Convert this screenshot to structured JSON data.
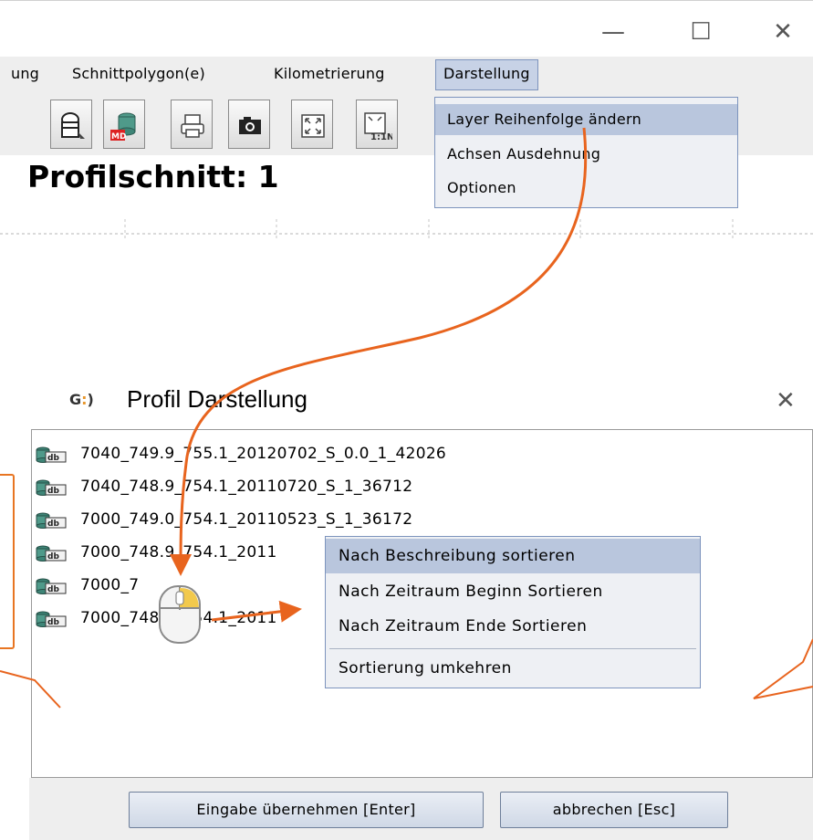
{
  "window": {
    "minimize_glyph": "—",
    "maximize_glyph": "☐",
    "close_glyph": "✕"
  },
  "menubar": {
    "items": [
      "ung",
      "Schnittpolygon(e)",
      "Kilometrierung",
      "Darstellung"
    ]
  },
  "toolbar": {
    "icons": [
      "select-tool-icon",
      "database-md-icon",
      "print-icon",
      "camera-icon",
      "zoom-extent-icon",
      "zoom-1-1-icon"
    ],
    "zoom_label": "1:1N"
  },
  "profile_title": "Profilschnitt: 1",
  "darstellung_menu": {
    "items": [
      "Layer Reihenfolge ändern",
      "Achsen Ausdehnung",
      "Optionen"
    ],
    "selected_index": 0
  },
  "dialog": {
    "logo": "G:)",
    "title": "Profil Darstellung",
    "close_glyph": "✕",
    "layers": [
      "7040_749.9_755.1_20120702_S_0.0_1_42026",
      "7040_748.9_754.1_20110720_S_1_36712",
      "7000_749.0_754.1_20110523_S_1_36172",
      "7000_748.9_754.1_2011",
      "7000_7",
      "7000_748.9_754.1_2011"
    ],
    "layer_icon": "db-layer-icon",
    "buttons": {
      "confirm": "Eingabe übernehmen [Enter]",
      "cancel": "abbrechen [Esc]"
    }
  },
  "context_menu": {
    "items": [
      "Nach Beschreibung sortieren",
      "Nach Zeitraum Beginn Sortieren",
      "Nach Zeitraum Ende Sortieren",
      "Sortierung umkehren"
    ],
    "selected_index": 0
  },
  "colors": {
    "annotation": "#e8641e",
    "menu_selected": "#b9c6dd",
    "menu_border": "#7d94bd",
    "panel_bg": "#eeeeee"
  }
}
